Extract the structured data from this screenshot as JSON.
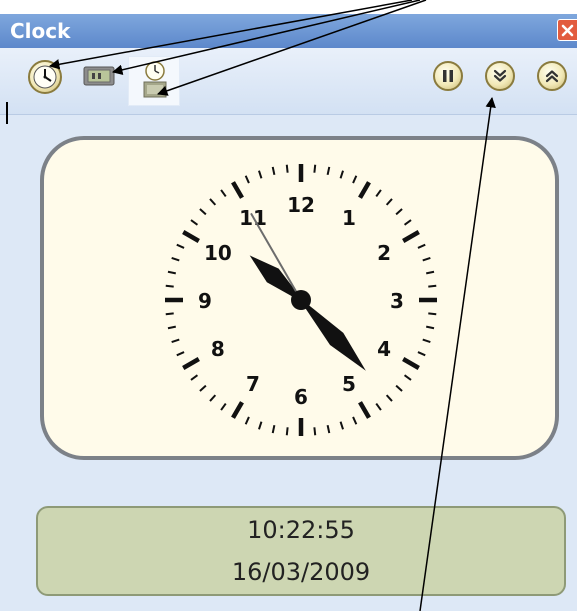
{
  "window": {
    "title": "Clock"
  },
  "toolbar": {
    "icons": [
      "analog-clock-icon",
      "digital-clock-icon",
      "clock-calendar-icon"
    ],
    "buttons": [
      "pause-icon",
      "chevron-down-icon",
      "chevron-up-icon"
    ]
  },
  "analog_clock": {
    "numerals": [
      "12",
      "1",
      "2",
      "3",
      "4",
      "5",
      "6",
      "7",
      "8",
      "9",
      "10",
      "11"
    ],
    "hour": 10,
    "minute": 22,
    "second": 55
  },
  "digital": {
    "time": "10:22:55",
    "date": "16/03/2009"
  },
  "colors": {
    "titlebar": "#5d88cb",
    "clock_face": "#fffbea",
    "digital_panel": "#cdd6b2"
  }
}
